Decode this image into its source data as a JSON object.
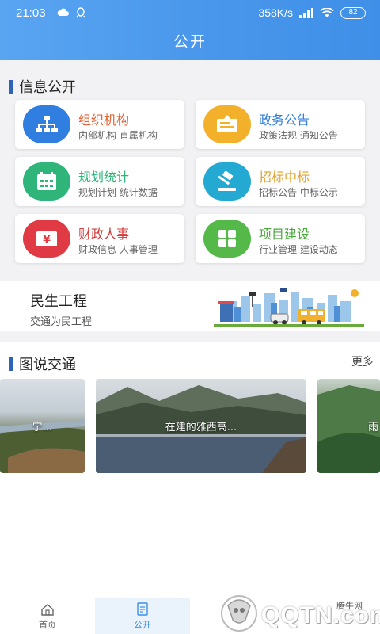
{
  "statusbar": {
    "time": "21:03",
    "speed": "358K/s",
    "battery": "82"
  },
  "header": {
    "title": "公开"
  },
  "section_info": {
    "title": "信息公开"
  },
  "cards": [
    {
      "title": "组织机构",
      "sub": "内部机构 直属机构",
      "icon": "org-chart-icon",
      "color": "#2f7ee0",
      "title_color": "#e0663a"
    },
    {
      "title": "政务公告",
      "sub": "政策法规 通知公告",
      "icon": "notice-board-icon",
      "color": "#f3b12b",
      "title_color": "#2f7ee0"
    },
    {
      "title": "规划统计",
      "sub": "规划计划 统计数据",
      "icon": "calendar-icon",
      "color": "#2fb57a",
      "title_color": "#2fb57a"
    },
    {
      "title": "招标中标",
      "sub": "招标公告 中标公示",
      "icon": "gavel-icon",
      "color": "#24a9d2",
      "title_color": "#e3a12b"
    },
    {
      "title": "财政人事",
      "sub": "财政信息 人事管理",
      "icon": "yuan-wallet-icon",
      "color": "#e03a44",
      "title_color": "#d43b3b"
    },
    {
      "title": "项目建设",
      "sub": "行业管理 建设动态",
      "icon": "grid-icon",
      "color": "#54b948",
      "title_color": "#4aa83c"
    }
  ],
  "banner": {
    "title": "民生工程",
    "subtitle": "交通为民工程"
  },
  "section_gallery": {
    "title": "图说交通",
    "more": "更多"
  },
  "gallery": [
    {
      "caption": "宁..."
    },
    {
      "caption": "在建的雅西高..."
    },
    {
      "caption": "雨"
    }
  ],
  "tabs": [
    {
      "label": "首页",
      "icon": "home-icon"
    },
    {
      "label": "公开",
      "icon": "document-icon"
    },
    {
      "label": "",
      "icon": ""
    },
    {
      "label": "",
      "icon": ""
    }
  ],
  "watermark": {
    "text": "QQTN.com",
    "site": "腾牛网"
  }
}
